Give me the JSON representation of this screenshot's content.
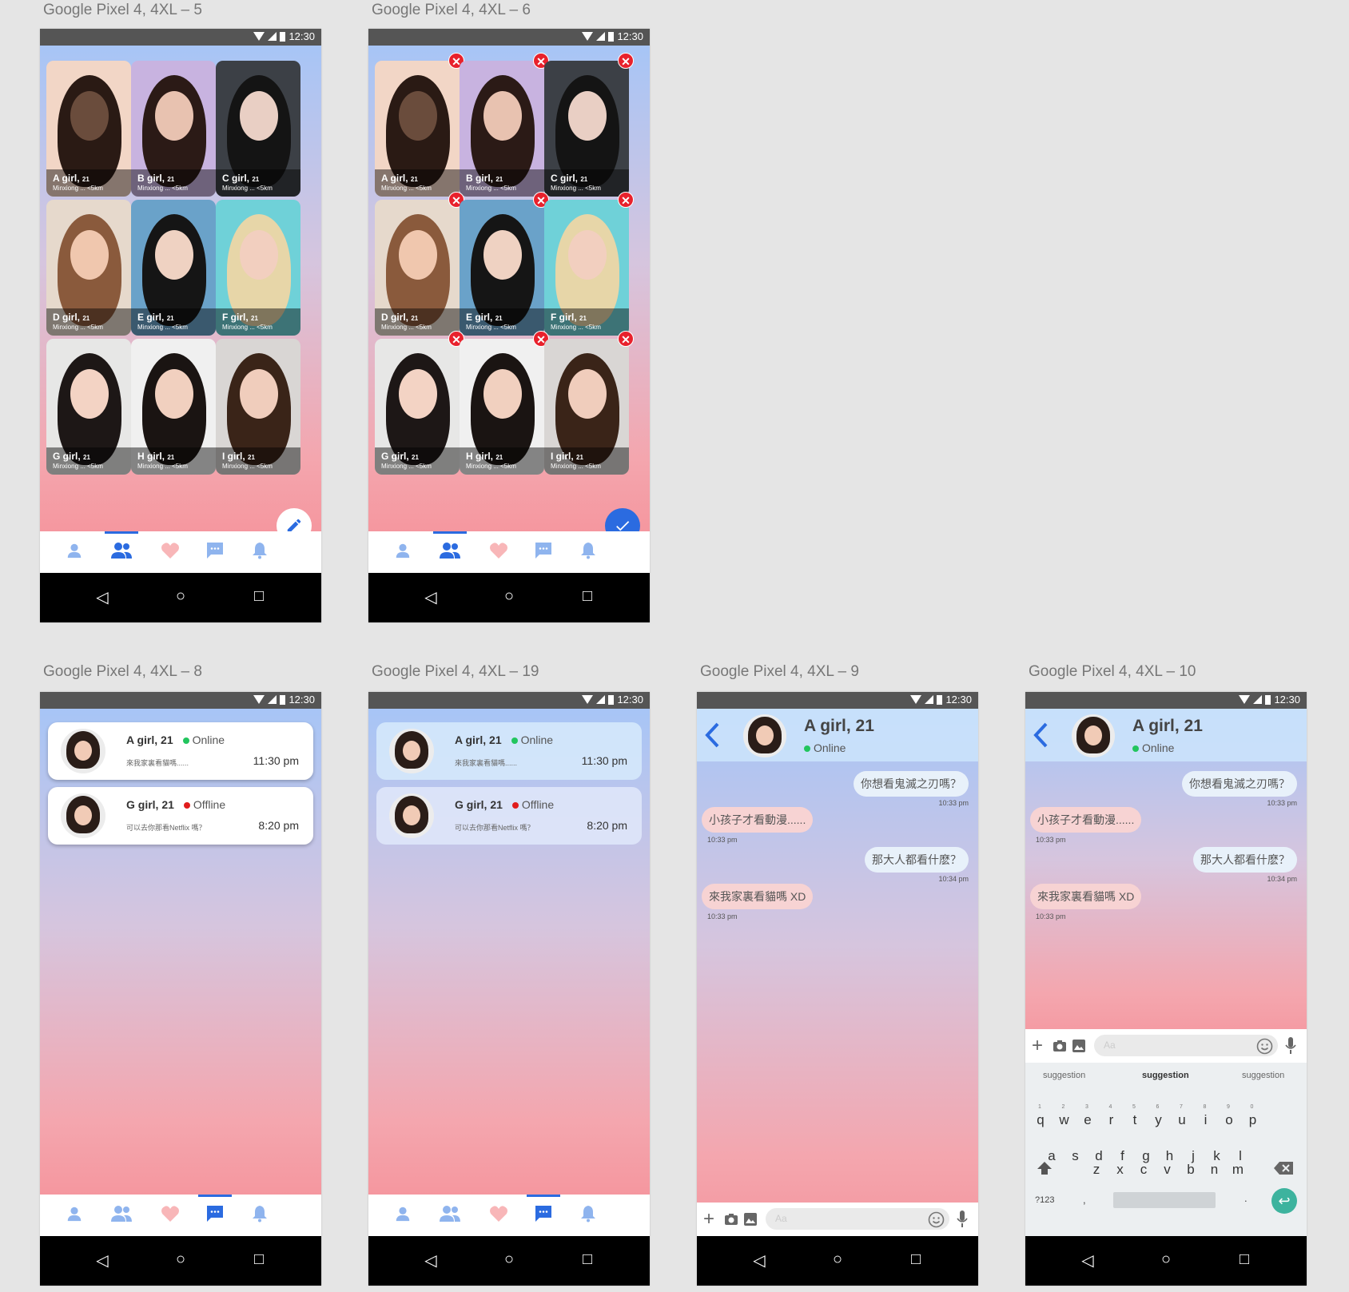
{
  "frames": [
    {
      "label": "Google Pixel 4, 4XL – 5"
    },
    {
      "label": "Google Pixel 4, 4XL – 6"
    },
    {
      "label": "Google Pixel 4, 4XL – 8"
    },
    {
      "label": "Google Pixel 4, 4XL – 19"
    },
    {
      "label": "Google Pixel 4, 4XL – 9"
    },
    {
      "label": "Google Pixel 4, 4XL – 10"
    }
  ],
  "status": {
    "time": "12:30"
  },
  "cards": [
    {
      "letter": "A girl,",
      "age": "21",
      "dist": "Minxiong ... <5km"
    },
    {
      "letter": "B girl,",
      "age": "21",
      "dist": "Minxiong ... <5km"
    },
    {
      "letter": "C girl,",
      "age": "21",
      "dist": "Minxiong ... <5km"
    },
    {
      "letter": "D girl,",
      "age": "21",
      "dist": "Minxiong ... <5km"
    },
    {
      "letter": "E girl,",
      "age": "21",
      "dist": "Minxiong ... <5km"
    },
    {
      "letter": "F girl,",
      "age": "21",
      "dist": "Minxiong ... <5km"
    },
    {
      "letter": "G girl,",
      "age": "21",
      "dist": "Minxiong ... <5km"
    },
    {
      "letter": "H girl,",
      "age": "21",
      "dist": "Minxiong ... <5km"
    },
    {
      "letter": "I girl,",
      "age": "21",
      "dist": "Minxiong ... <5km"
    }
  ],
  "chats": [
    {
      "name": "A girl, 21",
      "status": "Online",
      "message": "來我家裏看貓嗎......",
      "time": "11:30 pm"
    },
    {
      "name": "G girl, 21",
      "status": "Offline",
      "message": "可以去你那看Netflix 嗎？",
      "time": "8:20 pm"
    }
  ],
  "conversation": {
    "name": "A girl, 21",
    "status": "Online",
    "messages": [
      {
        "side": "right",
        "text": "你想看鬼滅之刃嗎？",
        "time": "10:33 pm"
      },
      {
        "side": "left",
        "text": "小孩子才看動漫......",
        "time": "10:33 pm"
      },
      {
        "side": "right",
        "text": "那大人都看什麽？",
        "time": "10:34 pm"
      },
      {
        "side": "left",
        "text": "來我家裏看貓嗎 XD",
        "time": "10:33 pm"
      }
    ],
    "input_placeholder": "Aa"
  },
  "keyboard": {
    "suggestions": [
      "suggestion",
      "suggestion",
      "suggestion"
    ],
    "row1": [
      "q",
      "w",
      "e",
      "r",
      "t",
      "y",
      "u",
      "i",
      "o",
      "p"
    ],
    "row1_nums": [
      "1",
      "2",
      "3",
      "4",
      "5",
      "6",
      "7",
      "8",
      "9",
      "0"
    ],
    "row2": [
      "a",
      "s",
      "d",
      "f",
      "g",
      "h",
      "j",
      "k",
      "l"
    ],
    "row3": [
      "z",
      "x",
      "c",
      "v",
      "b",
      "n",
      "m"
    ],
    "sym": "?123",
    "comma": ",",
    "period": "."
  },
  "colors": {
    "accent": "#2b6be0",
    "online": "#22c55e",
    "offline": "#e11d1d",
    "delete": "#e8212c"
  },
  "icons": [
    "person-icon",
    "group-icon",
    "heart-icon",
    "chat-icon",
    "bell-icon",
    "pencil-icon",
    "check-icon",
    "close-icon",
    "back-icon",
    "plus-icon",
    "camera-icon",
    "image-icon",
    "emoji-icon",
    "mic-icon",
    "shift-icon",
    "backspace-icon",
    "enter-icon"
  ]
}
